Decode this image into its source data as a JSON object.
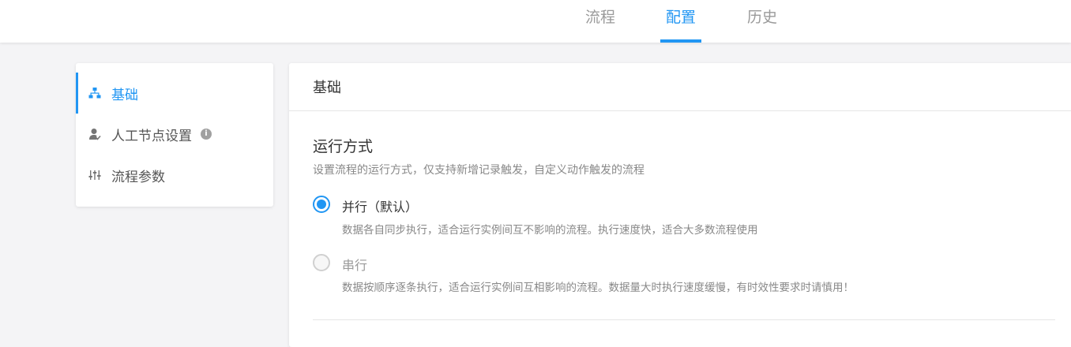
{
  "tabs": {
    "flow": "流程",
    "config": "配置",
    "history": "历史",
    "active_color": "#2196f3"
  },
  "sidebar": {
    "items": [
      {
        "label": "基础",
        "icon": "sitemap-icon",
        "active": true
      },
      {
        "label": "人工节点设置",
        "icon": "user-check-icon",
        "info": "i"
      },
      {
        "label": "流程参数",
        "icon": "sliders-icon"
      }
    ]
  },
  "panel": {
    "title": "基础",
    "section_title": "运行方式",
    "section_desc": "设置流程的运行方式，仅支持新增记录触发，自定义动作触发的流程",
    "options": [
      {
        "label": "并行（默认）",
        "desc": "数据各自同步执行，适合运行实例间互不影响的流程。执行速度快，适合大多数流程使用",
        "selected": true
      },
      {
        "label": "串行",
        "desc": "数据按顺序逐条执行，适合运行实例间互相影响的流程。数据量大时执行速度缓慢，有时效性要求时请慎用！",
        "selected": false
      }
    ]
  }
}
